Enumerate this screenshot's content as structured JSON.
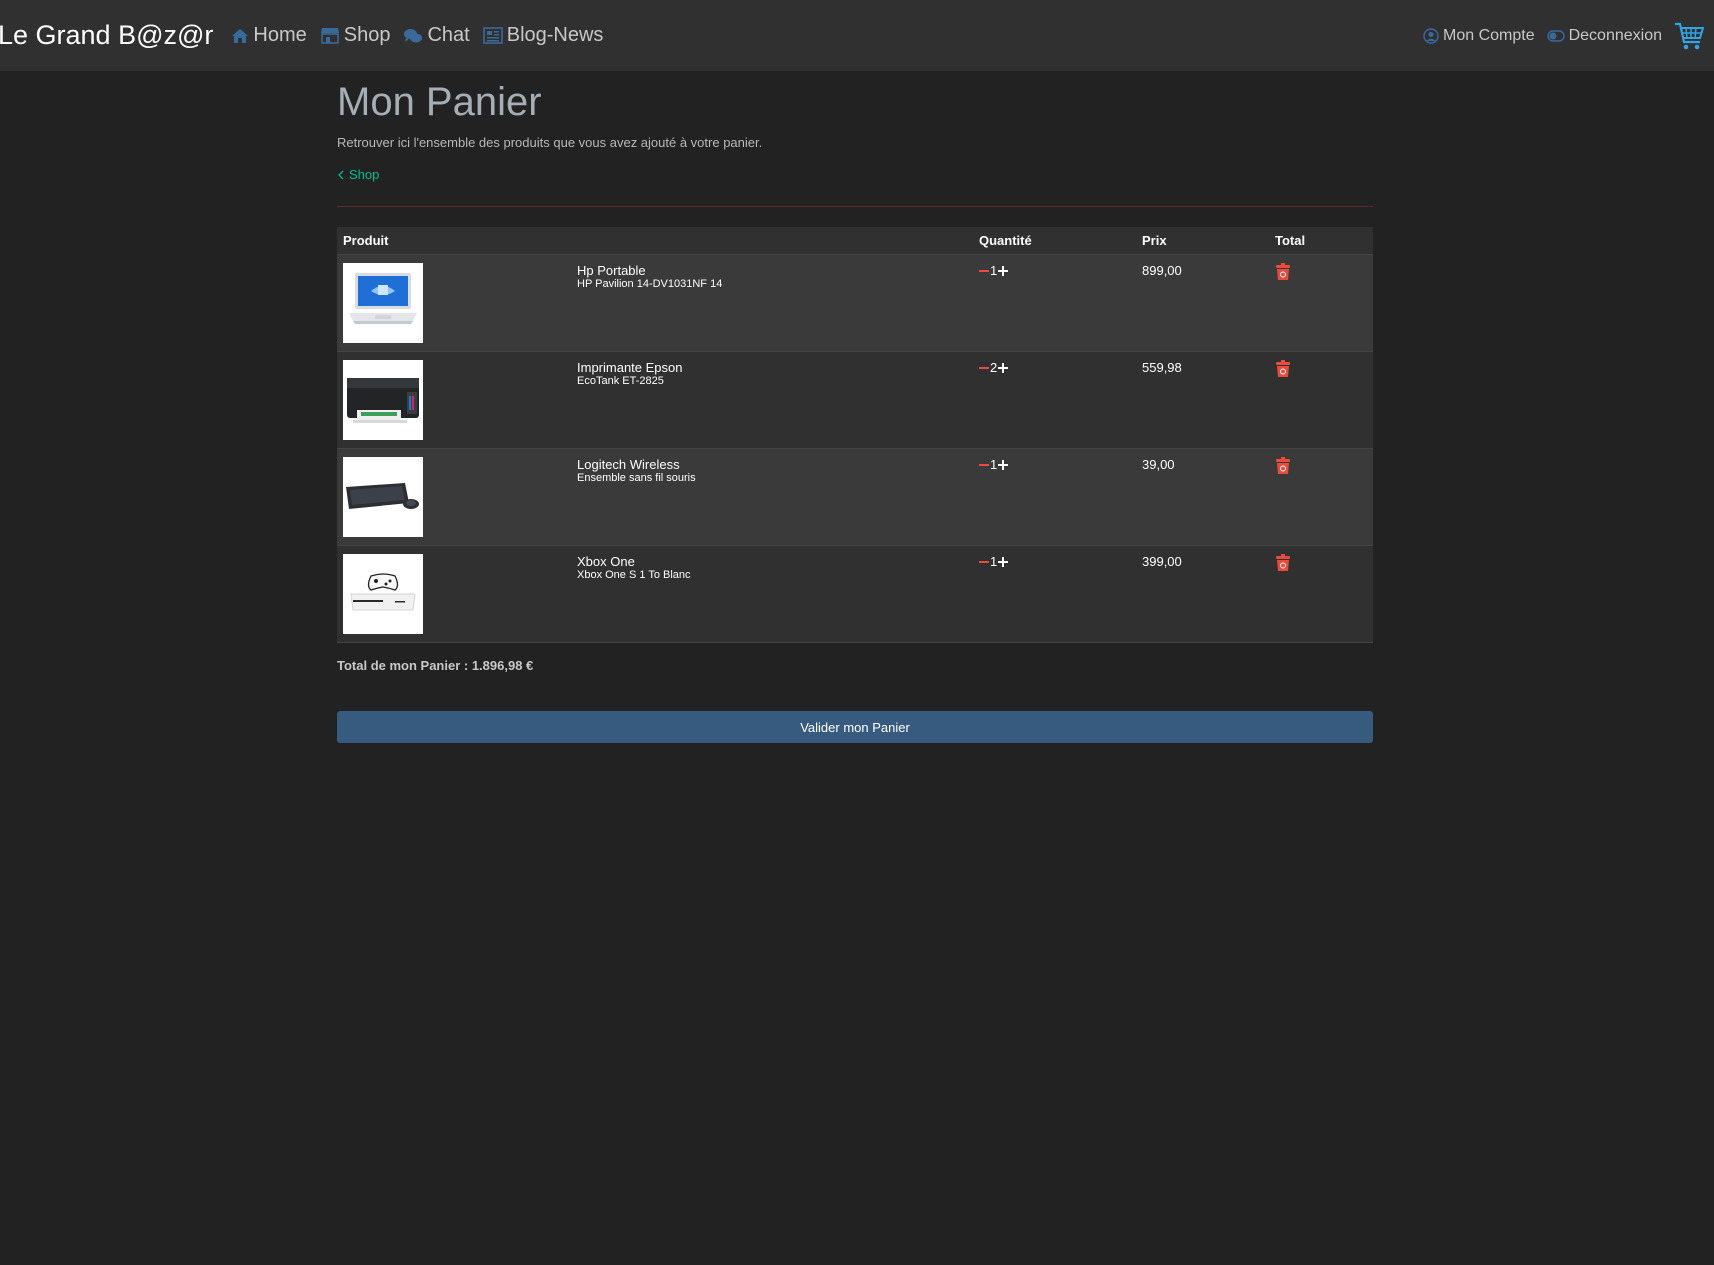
{
  "navbar": {
    "brand": "Le Grand B@z@r",
    "links": [
      {
        "label": "Home",
        "icon": "home-icon"
      },
      {
        "label": "Shop",
        "icon": "shop-icon"
      },
      {
        "label": "Chat",
        "icon": "chat-icon"
      },
      {
        "label": "Blog-News",
        "icon": "newspaper-icon"
      }
    ],
    "account_label": "Mon Compte",
    "logout_label": "Deconnexion",
    "cart_icon": "cart-icon",
    "accent_color": "#3a6a9c",
    "cart_color": "#2fa4e7"
  },
  "page": {
    "title": "Mon Panier",
    "subtitle": "Retrouver ici l'ensemble des produits que vous avez ajouté à votre panier.",
    "back_link": "Shop"
  },
  "table": {
    "headers": {
      "product": "Produit",
      "quantity": "Quantité",
      "price": "Prix",
      "total": "Total"
    },
    "rows": [
      {
        "name": "Hp Portable",
        "desc": "HP Pavilion 14-DV1031NF 14",
        "qty": "1",
        "price": "899,00",
        "image": "laptop"
      },
      {
        "name": "Imprimante Epson",
        "desc": "EcoTank ET-2825",
        "qty": "2",
        "price": "559,98",
        "image": "printer"
      },
      {
        "name": "Logitech Wireless",
        "desc": "Ensemble sans fil souris",
        "qty": "1",
        "price": "39,00",
        "image": "keyboard"
      },
      {
        "name": "Xbox One",
        "desc": "Xbox One S 1 To Blanc",
        "qty": "1",
        "price": "399,00",
        "image": "xbox"
      }
    ]
  },
  "summary": {
    "total_text": "Total de mon Panier : 1.896,98 €",
    "validate_label": "Valider mon Panier"
  },
  "colors": {
    "background": "#222222",
    "navbar": "#303030",
    "link": "#00bc8c",
    "button": "#375a7f",
    "minus": "#e74c3c",
    "trash": "#e74c3c"
  }
}
